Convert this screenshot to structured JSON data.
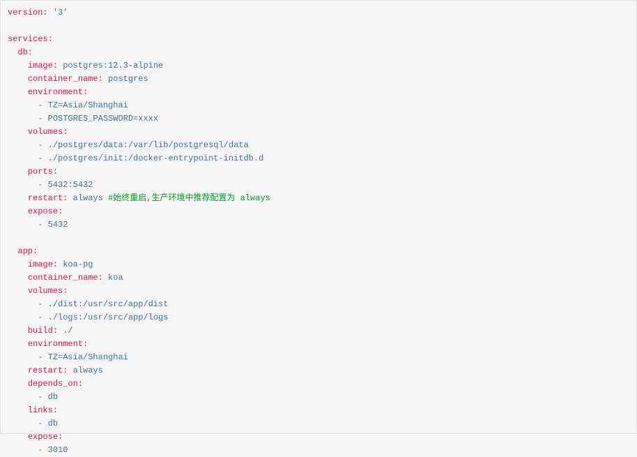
{
  "lines": [
    {
      "segments": [
        {
          "text": "version:",
          "class": "red"
        },
        {
          "text": " "
        },
        {
          "text": "'3'",
          "class": "blue"
        }
      ]
    },
    {
      "segments": [
        {
          "text": ""
        }
      ]
    },
    {
      "segments": [
        {
          "text": "services:",
          "class": "red"
        }
      ]
    },
    {
      "segments": [
        {
          "text": "  "
        },
        {
          "text": "db:",
          "class": "red"
        }
      ]
    },
    {
      "segments": [
        {
          "text": "    "
        },
        {
          "text": "image:",
          "class": "red"
        },
        {
          "text": " "
        },
        {
          "text": "postgres:12.3-alpine",
          "class": "blue"
        }
      ]
    },
    {
      "segments": [
        {
          "text": "    "
        },
        {
          "text": "container_name:",
          "class": "red"
        },
        {
          "text": " "
        },
        {
          "text": "postgres",
          "class": "blue"
        }
      ]
    },
    {
      "segments": [
        {
          "text": "    "
        },
        {
          "text": "environment:",
          "class": "red"
        }
      ]
    },
    {
      "segments": [
        {
          "text": "      "
        },
        {
          "text": "-",
          "class": "blue"
        },
        {
          "text": " "
        },
        {
          "text": "TZ=Asia/Shanghai",
          "class": "blue"
        }
      ]
    },
    {
      "segments": [
        {
          "text": "      "
        },
        {
          "text": "-",
          "class": "blue"
        },
        {
          "text": " "
        },
        {
          "text": "POSTGRES_PASSWORD=xxxx",
          "class": "blue"
        }
      ]
    },
    {
      "segments": [
        {
          "text": "    "
        },
        {
          "text": "volumes:",
          "class": "red"
        }
      ]
    },
    {
      "segments": [
        {
          "text": "      "
        },
        {
          "text": "-",
          "class": "blue"
        },
        {
          "text": " "
        },
        {
          "text": "./postgres/data:/var/lib/postgresql/data",
          "class": "blue"
        }
      ]
    },
    {
      "segments": [
        {
          "text": "      "
        },
        {
          "text": "-",
          "class": "blue"
        },
        {
          "text": " "
        },
        {
          "text": "./postgres/init:/docker-entrypoint-initdb.d",
          "class": "blue"
        }
      ]
    },
    {
      "segments": [
        {
          "text": "    "
        },
        {
          "text": "ports:",
          "class": "red"
        }
      ]
    },
    {
      "segments": [
        {
          "text": "      "
        },
        {
          "text": "-",
          "class": "blue"
        },
        {
          "text": " "
        },
        {
          "text": "5432:5432",
          "class": "blue"
        }
      ]
    },
    {
      "segments": [
        {
          "text": "    "
        },
        {
          "text": "restart:",
          "class": "red"
        },
        {
          "text": " "
        },
        {
          "text": "always",
          "class": "blue"
        },
        {
          "text": " "
        },
        {
          "text": "#始终重启,生产环境中推荐配置为 always",
          "class": "green"
        }
      ]
    },
    {
      "segments": [
        {
          "text": "    "
        },
        {
          "text": "expose:",
          "class": "red"
        }
      ]
    },
    {
      "segments": [
        {
          "text": "      "
        },
        {
          "text": "-",
          "class": "blue"
        },
        {
          "text": " "
        },
        {
          "text": "5432",
          "class": "blue"
        }
      ]
    },
    {
      "segments": [
        {
          "text": ""
        }
      ]
    },
    {
      "segments": [
        {
          "text": "  "
        },
        {
          "text": "app:",
          "class": "red"
        }
      ]
    },
    {
      "segments": [
        {
          "text": "    "
        },
        {
          "text": "image:",
          "class": "red"
        },
        {
          "text": " "
        },
        {
          "text": "koa-pg",
          "class": "blue"
        }
      ]
    },
    {
      "segments": [
        {
          "text": "    "
        },
        {
          "text": "container_name:",
          "class": "red"
        },
        {
          "text": " "
        },
        {
          "text": "koa",
          "class": "blue"
        }
      ]
    },
    {
      "segments": [
        {
          "text": "    "
        },
        {
          "text": "volumes:",
          "class": "red"
        }
      ]
    },
    {
      "segments": [
        {
          "text": "      "
        },
        {
          "text": "-",
          "class": "blue"
        },
        {
          "text": " "
        },
        {
          "text": "./dist:/usr/src/app/dist",
          "class": "blue"
        }
      ]
    },
    {
      "segments": [
        {
          "text": "      "
        },
        {
          "text": "-",
          "class": "blue"
        },
        {
          "text": " "
        },
        {
          "text": "./logs:/usr/src/app/logs",
          "class": "blue"
        }
      ]
    },
    {
      "segments": [
        {
          "text": "    "
        },
        {
          "text": "build:",
          "class": "red"
        },
        {
          "text": " "
        },
        {
          "text": "./",
          "class": "blue"
        }
      ]
    },
    {
      "segments": [
        {
          "text": "    "
        },
        {
          "text": "environment:",
          "class": "red"
        }
      ]
    },
    {
      "segments": [
        {
          "text": "      "
        },
        {
          "text": "-",
          "class": "blue"
        },
        {
          "text": " "
        },
        {
          "text": "TZ=Asia/Shanghai",
          "class": "blue"
        }
      ]
    },
    {
      "segments": [
        {
          "text": "    "
        },
        {
          "text": "restart:",
          "class": "red"
        },
        {
          "text": " "
        },
        {
          "text": "always",
          "class": "blue"
        }
      ]
    },
    {
      "segments": [
        {
          "text": "    "
        },
        {
          "text": "depends_on:",
          "class": "red"
        }
      ]
    },
    {
      "segments": [
        {
          "text": "      "
        },
        {
          "text": "-",
          "class": "blue"
        },
        {
          "text": " "
        },
        {
          "text": "db",
          "class": "blue"
        }
      ]
    },
    {
      "segments": [
        {
          "text": "    "
        },
        {
          "text": "links:",
          "class": "red"
        }
      ]
    },
    {
      "segments": [
        {
          "text": "      "
        },
        {
          "text": "-",
          "class": "blue"
        },
        {
          "text": " "
        },
        {
          "text": "db",
          "class": "blue"
        }
      ]
    },
    {
      "segments": [
        {
          "text": "    "
        },
        {
          "text": "expose:",
          "class": "red"
        }
      ]
    },
    {
      "segments": [
        {
          "text": "      "
        },
        {
          "text": "-",
          "class": "blue"
        },
        {
          "text": " "
        },
        {
          "text": "3010",
          "class": "blue"
        }
      ]
    }
  ]
}
